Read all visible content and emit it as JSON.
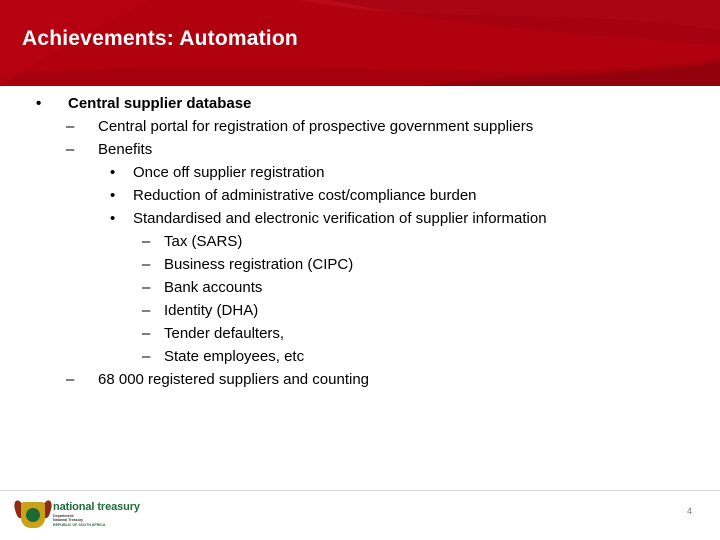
{
  "slide": {
    "title": "Achievements: Automation",
    "page_number": "4",
    "accent_color": "#b1000e",
    "bullets": [
      {
        "level": 1,
        "marker": "•",
        "text": "Central supplier database"
      },
      {
        "level": 2,
        "marker": "–",
        "text": "Central portal for registration of prospective government suppliers"
      },
      {
        "level": 2,
        "marker": "–",
        "text": "Benefits"
      },
      {
        "level": 3,
        "marker": "•",
        "text": "Once off supplier registration"
      },
      {
        "level": 3,
        "marker": "•",
        "text": "Reduction of administrative cost/compliance burden"
      },
      {
        "level": 3,
        "marker": "•",
        "text": "Standardised and electronic verification of supplier information"
      },
      {
        "level": 4,
        "marker": "–",
        "text": "Tax (SARS)"
      },
      {
        "level": 4,
        "marker": "–",
        "text": "Business registration (CIPC)"
      },
      {
        "level": 4,
        "marker": "–",
        "text": "Bank accounts"
      },
      {
        "level": 4,
        "marker": "–",
        "text": "Identity (DHA)"
      },
      {
        "level": 4,
        "marker": "–",
        "text": "Tender defaulters,"
      },
      {
        "level": 4,
        "marker": "–",
        "text": "State employees, etc"
      },
      {
        "level": 2,
        "marker": "–",
        "text": "68 000 registered suppliers and counting"
      }
    ]
  },
  "footer": {
    "logo": {
      "name": "national treasury",
      "department_line1": "Department:",
      "department_line2": "National Treasury",
      "republic": "REPUBLIC OF SOUTH AFRICA"
    }
  }
}
